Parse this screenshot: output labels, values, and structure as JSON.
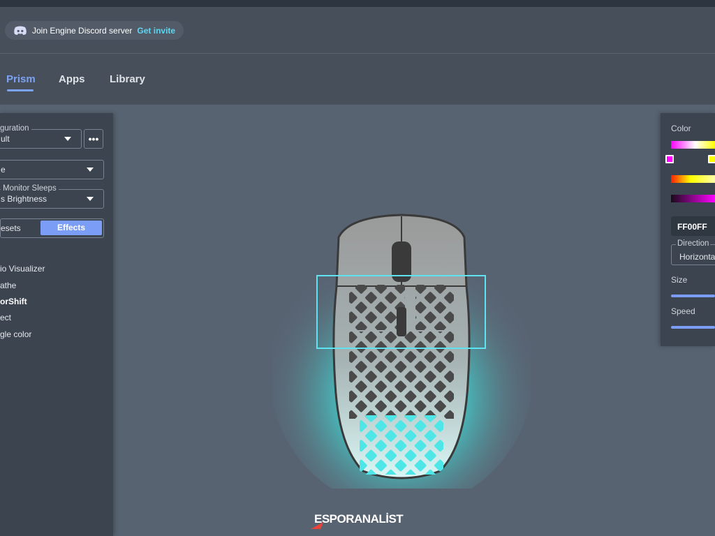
{
  "banner": {
    "text": "Join Engine Discord server",
    "link": "Get invite",
    "icon": "discord-icon"
  },
  "tabs": [
    {
      "label": "Prism",
      "active": true
    },
    {
      "label": "Apps",
      "active": false
    },
    {
      "label": "Library",
      "active": false
    }
  ],
  "left_panel": {
    "configuration": {
      "legend": "guration",
      "value": "ult"
    },
    "mode_select": {
      "value": "e"
    },
    "monitor_sleeps": {
      "legend": "Monitor Sleeps",
      "value": "s Brightness"
    },
    "more_icon": "more-dots-icon",
    "segment": {
      "presets": "esets",
      "effects": "Effects",
      "selected": "Effects"
    },
    "effects": [
      {
        "label": "io Visualizer",
        "active": false
      },
      {
        "label": "athe",
        "active": false
      },
      {
        "label": "orShift",
        "active": true
      },
      {
        "label": "ect",
        "active": false
      },
      {
        "label": "gle color",
        "active": false
      }
    ]
  },
  "right_panel": {
    "color_label": "Color",
    "hex_value": "FF00FF",
    "direction": {
      "legend": "Direction",
      "value": "Horizonta"
    },
    "size_label": "Size",
    "speed_label": "Speed",
    "stop_colors": [
      "#ff00ff",
      "#ffff00"
    ]
  },
  "device": {
    "name_icon": "mouse-icon",
    "glow_color": "#3fe6e0",
    "zone_highlight_color": "#5fe3f0"
  },
  "watermark": {
    "part1": "ESPOR",
    "part2": "ANALİST"
  },
  "colors": {
    "accent": "#7ba3f2",
    "link": "#5fd6f0",
    "background": "#586372",
    "panel": "#3b444f"
  }
}
